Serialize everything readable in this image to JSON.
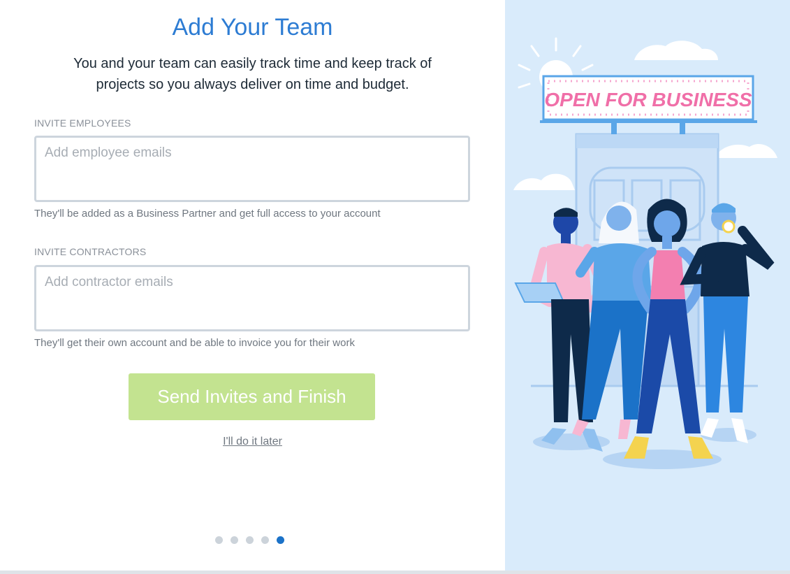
{
  "header": {
    "title": "Add Your Team",
    "subtitle_line1": "You and your team can easily track time and keep track of",
    "subtitle_line2": "projects so you always deliver on time and budget."
  },
  "employees": {
    "label": "INVITE EMPLOYEES",
    "placeholder": "Add employee emails",
    "value": "",
    "hint": "They'll be added as a Business Partner and get full access to your account"
  },
  "contractors": {
    "label": "INVITE CONTRACTORS",
    "placeholder": "Add contractor emails",
    "value": "",
    "hint": "They'll get their own account and be able to invoice you for their work"
  },
  "actions": {
    "primary_label": "Send Invites and Finish",
    "later_label": "I'll do it later"
  },
  "pagination": {
    "total": 5,
    "current": 5
  },
  "illustration": {
    "sign_text": "OPEN FOR BUSINESS"
  },
  "colors": {
    "accent": "#2d7cd3",
    "button": "#c3e390",
    "panel": "#d9ebfb",
    "active_dot": "#1b72c8"
  }
}
